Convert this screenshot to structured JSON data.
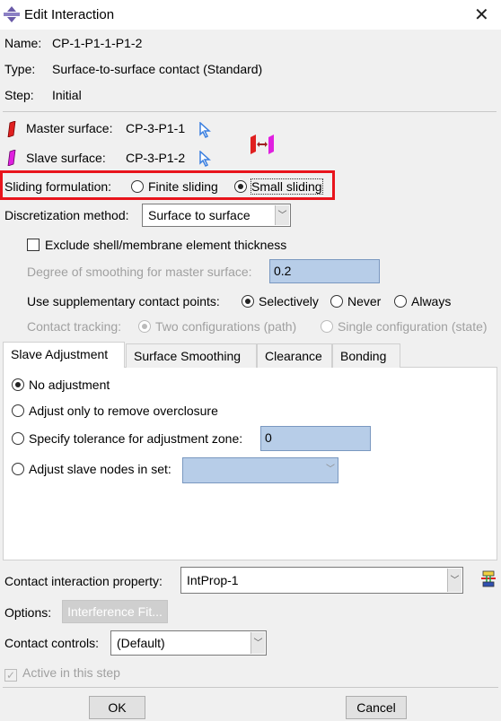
{
  "window": {
    "title": "Edit Interaction",
    "close": "✕"
  },
  "info": {
    "name_label": "Name:",
    "name": "CP-1-P1-1-P1-2",
    "type_label": "Type:",
    "type": "Surface-to-surface contact (Standard)",
    "step_label": "Step:",
    "step": "Initial"
  },
  "surfaces": {
    "master_label": "Master surface:",
    "master": "CP-3-P1-1",
    "slave_label": "Slave surface:",
    "slave": "CP-3-P1-2",
    "master_color": "#e02020",
    "slave_color": "#e020e0"
  },
  "sliding": {
    "label": "Sliding formulation:",
    "finite": "Finite sliding",
    "small": "Small sliding",
    "selected": "Small sliding",
    "highlight_color": "#e8141c"
  },
  "discretization": {
    "label": "Discretization method:",
    "value": "Surface to surface"
  },
  "exclude_thickness": {
    "label": "Exclude shell/membrane element thickness",
    "checked": false
  },
  "smoothing": {
    "label": "Degree of smoothing for master surface:",
    "value": "0.2"
  },
  "supplementary": {
    "label": "Use supplementary contact points:",
    "options": [
      "Selectively",
      "Never",
      "Always"
    ],
    "selected": "Selectively"
  },
  "tracking": {
    "label": "Contact tracking:",
    "options": [
      "Two configurations (path)",
      "Single configuration (state)"
    ],
    "selected": "Two configurations (path)"
  },
  "tabs": [
    "Slave Adjustment",
    "Surface Smoothing",
    "Clearance",
    "Bonding"
  ],
  "slave_adjustment": {
    "options": [
      "No adjustment",
      "Adjust only to remove overclosure",
      "Specify tolerance for adjustment zone:",
      "Adjust slave nodes in set:"
    ],
    "selected": "No adjustment",
    "tolerance": "0",
    "node_set": ""
  },
  "property": {
    "label": "Contact interaction property:",
    "value": "IntProp-1"
  },
  "options": {
    "label": "Options:",
    "button": "Interference Fit..."
  },
  "controls": {
    "label": "Contact controls:",
    "value": "(Default)"
  },
  "active": {
    "label": "Active in this step",
    "checked": true
  },
  "buttons": {
    "ok": "OK",
    "cancel": "Cancel"
  }
}
